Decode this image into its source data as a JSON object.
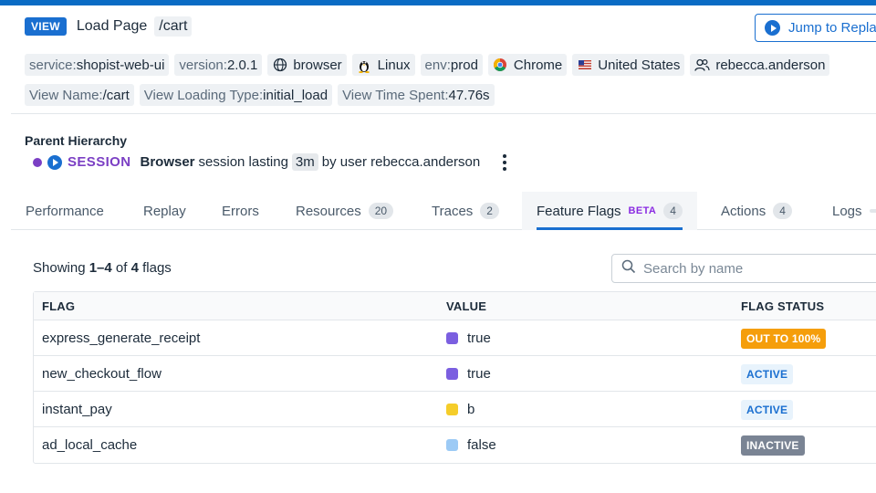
{
  "header": {
    "badge": "VIEW",
    "title": "Load Page",
    "path": "/cart",
    "jump_button": "Jump to Replay"
  },
  "tags_row1": [
    {
      "key": "service:",
      "value": "shopist-web-ui",
      "icon": ""
    },
    {
      "key": "version:",
      "value": "2.0.1",
      "icon": ""
    },
    {
      "key": "",
      "value": "browser",
      "icon": "globe-icon"
    },
    {
      "key": "",
      "value": "Linux",
      "icon": "linux-icon"
    },
    {
      "key": "env:",
      "value": "prod",
      "icon": ""
    },
    {
      "key": "",
      "value": "Chrome",
      "icon": "chrome-icon"
    },
    {
      "key": "",
      "value": "United States",
      "icon": "us-flag-icon"
    },
    {
      "key": "",
      "value": "rebecca.anderson",
      "icon": "user-icon"
    }
  ],
  "tags_row2": [
    {
      "key": "View Name:",
      "value": "/cart"
    },
    {
      "key": "View Loading Type:",
      "value": "initial_load"
    },
    {
      "key": "View Time Spent:",
      "value": "47.76s"
    }
  ],
  "parent_hierarchy": {
    "title": "Parent Hierarchy",
    "session_label": "SESSION",
    "browser": "Browser",
    "lasting_text": "session lasting",
    "duration": "3m",
    "by_user_text": "by user rebecca.anderson"
  },
  "tabs": [
    {
      "label": "Performance",
      "count": null
    },
    {
      "label": "Replay",
      "count": null
    },
    {
      "label": "Errors",
      "count": null
    },
    {
      "label": "Resources",
      "count": "20"
    },
    {
      "label": "Traces",
      "count": "2"
    },
    {
      "label": "Feature Flags",
      "count": "4",
      "badge": "BETA",
      "active": true
    },
    {
      "label": "Actions",
      "count": "4"
    },
    {
      "label": "Logs",
      "count": ""
    }
  ],
  "flags": {
    "showing_prefix": "Showing",
    "showing_range": "1–4",
    "showing_of": "of",
    "showing_total": "4",
    "showing_suffix": "flags",
    "search_placeholder": "Search by name",
    "columns": [
      "FLAG",
      "VALUE",
      "FLAG STATUS"
    ],
    "rows": [
      {
        "flag": "express_generate_receipt",
        "value": "true",
        "swatch": "#7b5fe0",
        "status": "OUT TO 100%",
        "status_type": "rollout"
      },
      {
        "flag": "new_checkout_flow",
        "value": "true",
        "swatch": "#7b5fe0",
        "status": "ACTIVE",
        "status_type": "active"
      },
      {
        "flag": "instant_pay",
        "value": "b",
        "swatch": "#f5cd2a",
        "status": "ACTIVE",
        "status_type": "active"
      },
      {
        "flag": "ad_local_cache",
        "value": "false",
        "swatch": "#9ccaf5",
        "status": "INACTIVE",
        "status_type": "inactive"
      }
    ]
  },
  "colors": {
    "accent": "#1a6fd0",
    "session_purple": "#7b3fc4",
    "rollout_orange": "#f59e0b"
  }
}
